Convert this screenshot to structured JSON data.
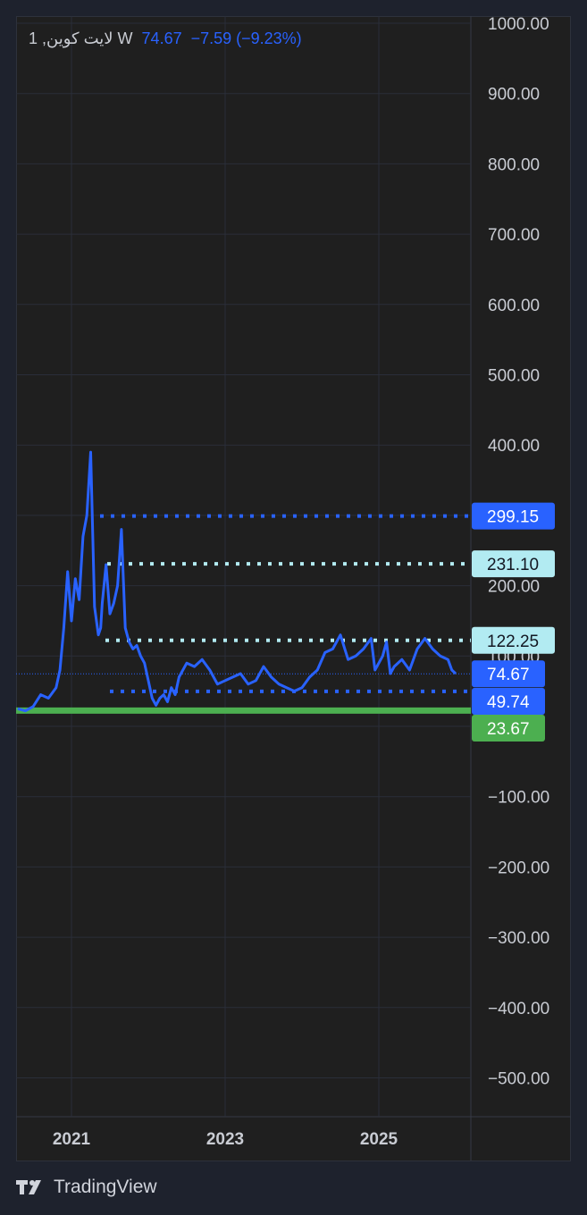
{
  "legend": {
    "symbol": "1 ,لایت کوین W",
    "price": "74.67",
    "change": "−7.59 (−9.23%)"
  },
  "footer": {
    "brand": "TradingView"
  },
  "colors": {
    "series": "#2962ff",
    "resistance_dotted": "#b2ebf2",
    "support_dotted": "#2962ff",
    "baseline": "#4caf50",
    "grid": "#2a2e39",
    "axis_text": "#c9ccd3"
  },
  "chart_data": {
    "type": "line",
    "ylim": [
      -550,
      1000
    ],
    "y_ticks": [
      1000,
      900,
      800,
      700,
      600,
      500,
      400,
      300,
      200,
      100,
      0,
      -100,
      -200,
      -300,
      -400,
      -500
    ],
    "y_tick_labels": [
      "1000.00",
      "900.00",
      "800.00",
      "700.00",
      "600.00",
      "500.00",
      "400.00",
      "",
      "200.00",
      "100.00",
      "",
      "−100.00",
      "−200.00",
      "−300.00",
      "−400.00",
      "−500.00"
    ],
    "x_ticks": [
      2021,
      2023,
      2025
    ],
    "x_tick_labels": [
      "2021",
      "2023",
      "2025"
    ],
    "series": [
      {
        "x": [
          2020.3,
          2020.4,
          2020.5,
          2020.6,
          2020.7,
          2020.8,
          2020.85,
          2020.9,
          2020.95,
          2021.0,
          2021.05,
          2021.1,
          2021.15,
          2021.2,
          2021.25,
          2021.3,
          2021.35,
          2021.38,
          2021.4,
          2021.45,
          2021.5,
          2021.55,
          2021.6,
          2021.65,
          2021.7,
          2021.75,
          2021.8,
          2021.85,
          2021.9,
          2021.95,
          2022.0,
          2022.05,
          2022.1,
          2022.15,
          2022.2,
          2022.25,
          2022.3,
          2022.35,
          2022.4,
          2022.5,
          2022.6,
          2022.7,
          2022.8,
          2022.9,
          2023.0,
          2023.1,
          2023.2,
          2023.3,
          2023.4,
          2023.5,
          2023.6,
          2023.7,
          2023.8,
          2023.9,
          2024.0,
          2024.1,
          2024.2,
          2024.3,
          2024.4,
          2024.5,
          2024.6,
          2024.7,
          2024.8,
          2024.9,
          2024.95,
          2025.0,
          2025.05,
          2025.1,
          2025.15,
          2025.2,
          2025.3,
          2025.4,
          2025.5,
          2025.6,
          2025.7,
          2025.8,
          2025.9,
          2025.95,
          2026.0
        ],
        "y": [
          25,
          22,
          28,
          45,
          40,
          55,
          80,
          140,
          220,
          150,
          210,
          180,
          270,
          300,
          390,
          170,
          130,
          140,
          175,
          230,
          160,
          175,
          200,
          280,
          140,
          120,
          110,
          115,
          100,
          90,
          65,
          40,
          30,
          40,
          45,
          35,
          55,
          45,
          70,
          90,
          85,
          95,
          80,
          60,
          65,
          70,
          75,
          60,
          65,
          85,
          70,
          60,
          55,
          50,
          55,
          70,
          80,
          105,
          110,
          130,
          95,
          100,
          110,
          125,
          80,
          90,
          100,
          120,
          75,
          85,
          95,
          80,
          110,
          125,
          110,
          100,
          95,
          80,
          75
        ]
      }
    ],
    "levels": [
      {
        "label": "299.15",
        "value": 299.15,
        "style": "dotted",
        "color": "#2962ff"
      },
      {
        "label": "231.10",
        "value": 231.1,
        "style": "dotted",
        "color": "#b2ebf2"
      },
      {
        "label": "122.25",
        "value": 122.25,
        "style": "dotted",
        "color": "#b2ebf2"
      },
      {
        "label": "74.67",
        "value": 74.67,
        "style": "last-price",
        "color": "#2962ff"
      },
      {
        "label": "49.74",
        "value": 49.74,
        "style": "dotted",
        "color": "#2962ff"
      },
      {
        "label": "23.67",
        "value": 23.67,
        "style": "solid",
        "color": "#4caf50"
      }
    ],
    "grid": true
  }
}
